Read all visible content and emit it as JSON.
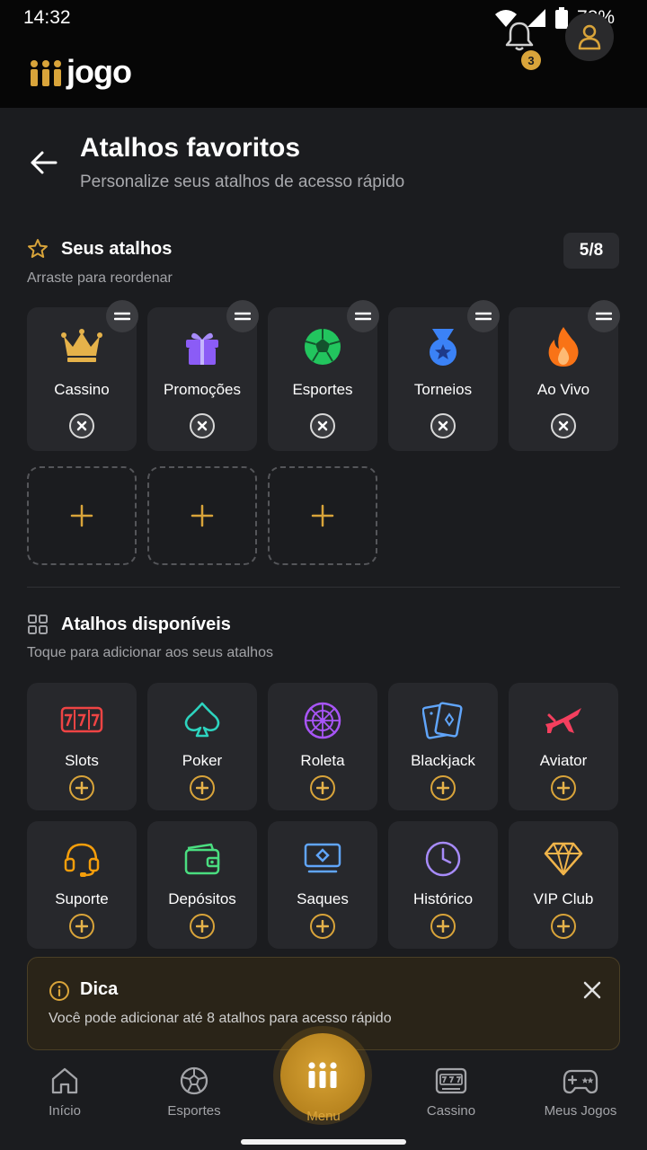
{
  "status_bar": {
    "time": "14:32",
    "battery": "78%"
  },
  "header": {
    "logo_text": "jogo",
    "notification_count": "3"
  },
  "page": {
    "title": "Atalhos favoritos",
    "subtitle": "Personalize seus atalhos de acesso rápido"
  },
  "favorites": {
    "title": "Seus atalhos",
    "hint": "Arraste para reordenar",
    "counter": "5/8",
    "items": [
      {
        "label": "Cassino",
        "icon": "crown-icon",
        "color": "#e5b24a"
      },
      {
        "label": "Promoções",
        "icon": "gift-icon",
        "color": "#8b5cf6"
      },
      {
        "label": "Esportes",
        "icon": "soccer-ball-icon",
        "color": "#22c55e"
      },
      {
        "label": "Torneios",
        "icon": "medal-icon",
        "color": "#3b82f6"
      },
      {
        "label": "Ao Vivo",
        "icon": "fire-icon",
        "color": "#f97316"
      }
    ]
  },
  "available": {
    "title": "Atalhos disponíveis",
    "hint": "Toque para adicionar aos seus atalhos",
    "items": [
      {
        "label": "Slots",
        "icon": "slot-machine-icon",
        "color": "#ef4444"
      },
      {
        "label": "Poker",
        "icon": "spade-icon",
        "color": "#2dd4bf"
      },
      {
        "label": "Roleta",
        "icon": "roulette-icon",
        "color": "#a855f7"
      },
      {
        "label": "Blackjack",
        "icon": "cards-icon",
        "color": "#60a5fa"
      },
      {
        "label": "Aviator",
        "icon": "airplane-icon",
        "color": "#f43f5e"
      },
      {
        "label": "Suporte",
        "icon": "headset-icon",
        "color": "#f59e0b"
      },
      {
        "label": "Depósitos",
        "icon": "wallet-icon",
        "color": "#4ade80"
      },
      {
        "label": "Saques",
        "icon": "cash-icon",
        "color": "#60a5fa"
      },
      {
        "label": "Histórico",
        "icon": "clock-icon",
        "color": "#a78bfa"
      },
      {
        "label": "VIP Club",
        "icon": "diamond-icon",
        "color": "#f0b44a"
      }
    ]
  },
  "tip": {
    "title": "Dica",
    "text": "Você pode adicionar até 8 atalhos para acesso rápido"
  },
  "bottom_nav": {
    "items": [
      {
        "label": "Início",
        "icon": "home-icon"
      },
      {
        "label": "Esportes",
        "icon": "soccer-ball-icon"
      },
      {
        "label": "Menu",
        "icon": "logo-icon"
      },
      {
        "label": "Cassino",
        "icon": "slot-machine-icon"
      },
      {
        "label": "Meus Jogos",
        "icon": "gamepad-icon"
      }
    ]
  },
  "colors": {
    "accent": "#d9a43a",
    "background": "#1b1c1f",
    "tile": "#27282c"
  }
}
